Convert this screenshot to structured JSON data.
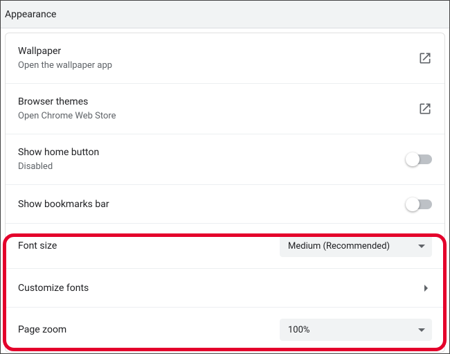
{
  "header": {
    "title": "Appearance"
  },
  "rows": {
    "wallpaper": {
      "title": "Wallpaper",
      "sub": "Open the wallpaper app"
    },
    "themes": {
      "title": "Browser themes",
      "sub": "Open Chrome Web Store"
    },
    "homebtn": {
      "title": "Show home button",
      "sub": "Disabled"
    },
    "bookmarks": {
      "title": "Show bookmarks bar"
    },
    "fontsize": {
      "title": "Font size",
      "value": "Medium (Recommended)"
    },
    "custfonts": {
      "title": "Customize fonts"
    },
    "zoom": {
      "title": "Page zoom",
      "value": "100%"
    }
  }
}
